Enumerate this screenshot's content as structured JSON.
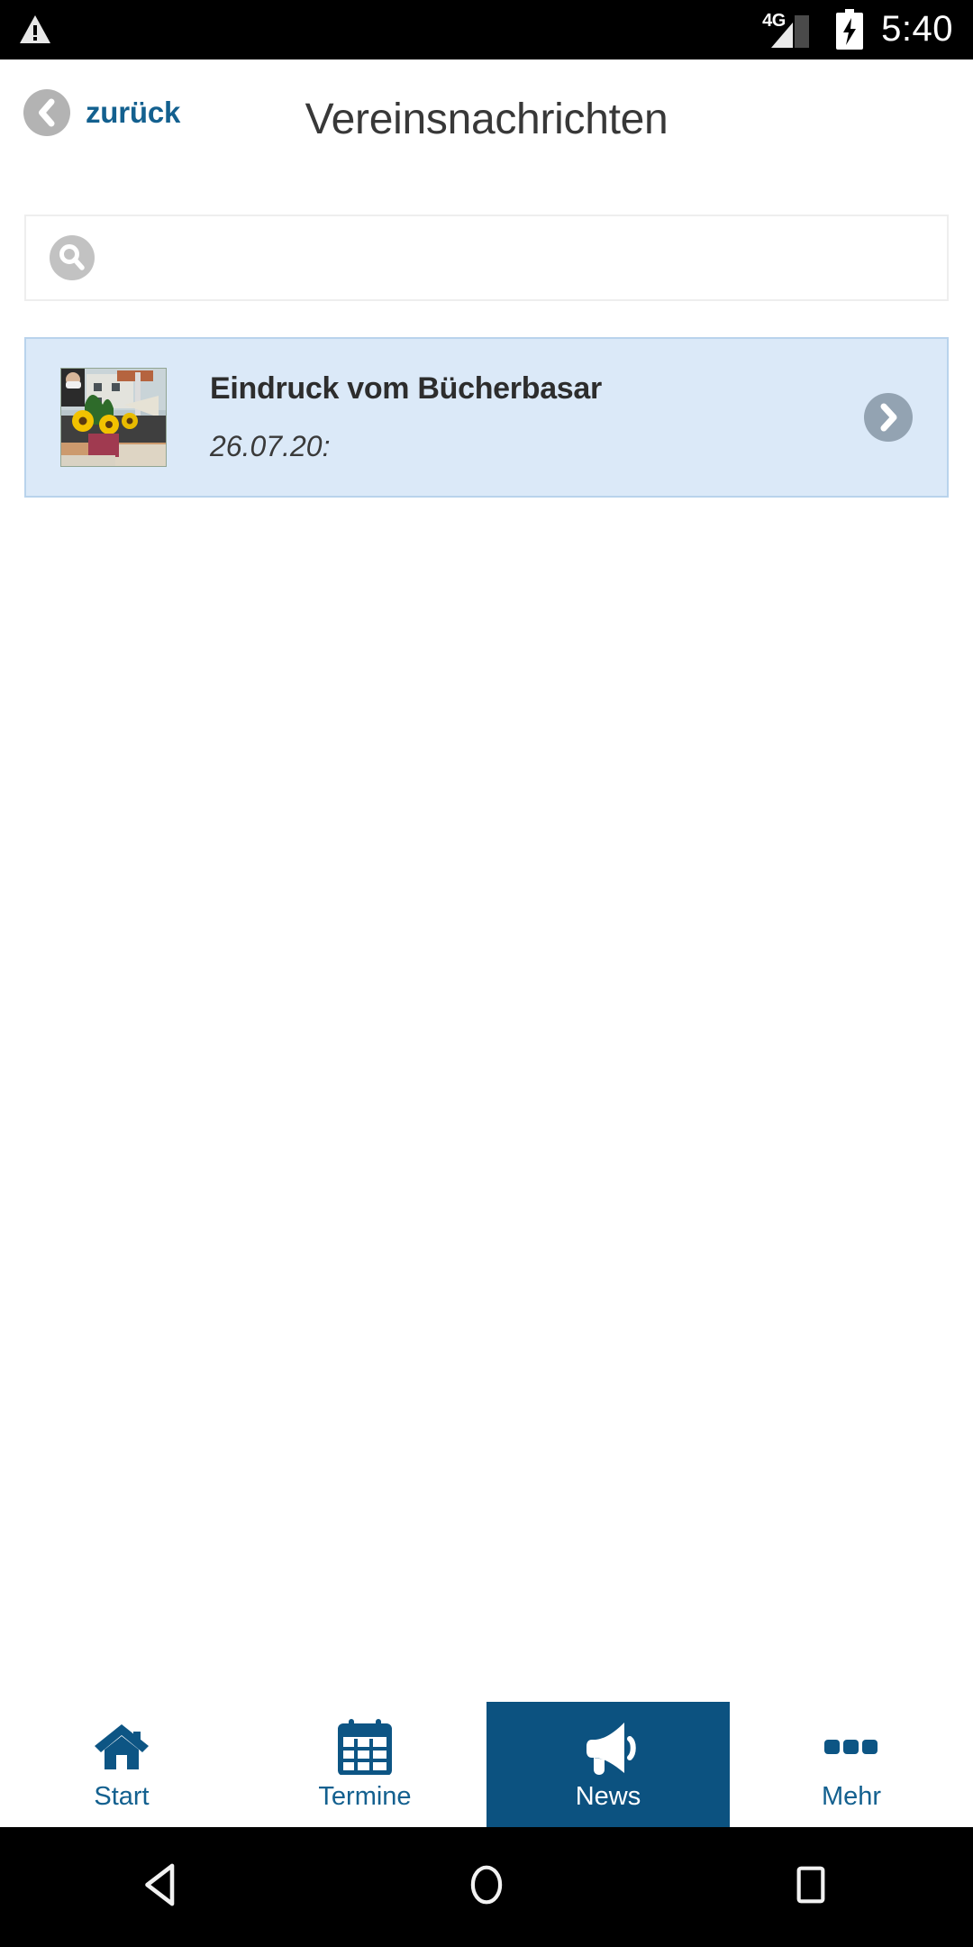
{
  "statusbar": {
    "warning_icon": "warning-triangle-icon",
    "network_label": "4G",
    "signal_icon": "signal-bars-icon",
    "battery_icon": "battery-charging-icon",
    "time": "5:40"
  },
  "header": {
    "back_label": "zurück",
    "back_icon": "chevron-left-icon",
    "title": "Vereinsnachrichten"
  },
  "search": {
    "icon": "search-icon",
    "value": "",
    "placeholder": ""
  },
  "news": {
    "items": [
      {
        "title": "Eindruck vom Bücherbasar",
        "date": "26.07.20:",
        "thumbnail_alt": "sunflowers-bookbazaar-photo",
        "chevron_icon": "chevron-right-icon"
      }
    ]
  },
  "tabbar": {
    "items": [
      {
        "label": "Start",
        "icon": "home-icon",
        "active": false
      },
      {
        "label": "Termine",
        "icon": "calendar-icon",
        "active": false
      },
      {
        "label": "News",
        "icon": "megaphone-icon",
        "active": true
      },
      {
        "label": "Mehr",
        "icon": "more-dots-icon",
        "active": false
      }
    ]
  },
  "androidnav": {
    "back": "triangle-back-icon",
    "home": "circle-home-icon",
    "recents": "square-recents-icon"
  },
  "colors": {
    "accent_blue": "#13608f",
    "active_tab_blue": "#0c5280",
    "card_bg": "#dbe9f8",
    "card_border": "#b9d3ec",
    "title_gray": "#383838"
  }
}
